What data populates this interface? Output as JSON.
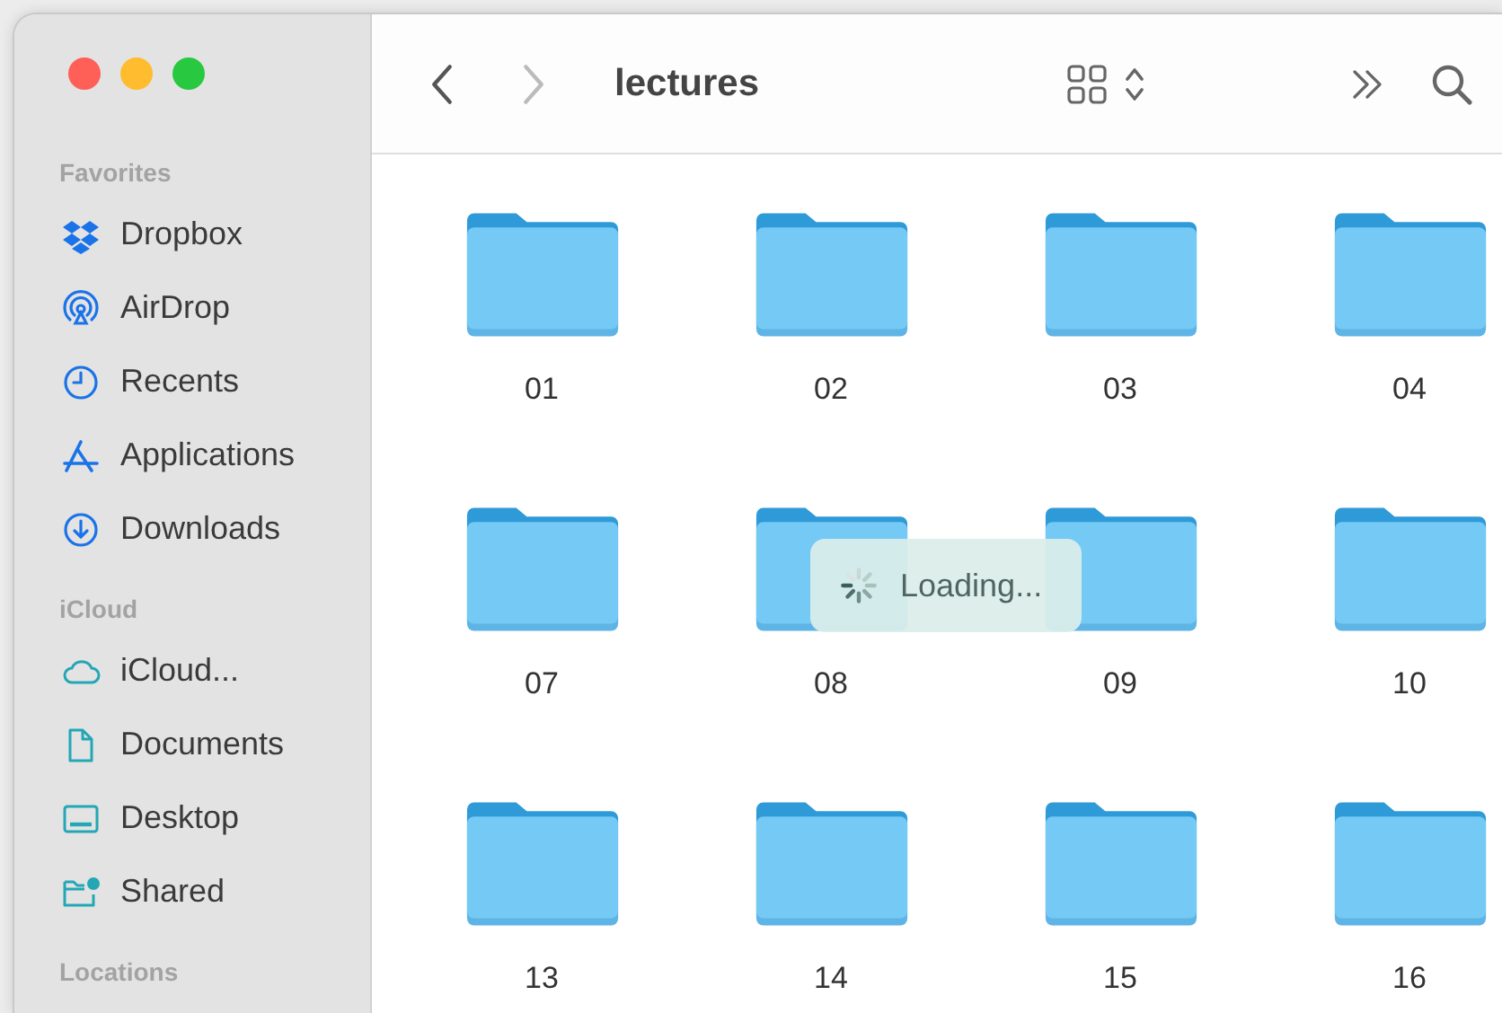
{
  "window": {
    "title": "lectures"
  },
  "toolbar": {
    "back": {
      "disabled": false
    },
    "forward": {
      "disabled": true
    }
  },
  "sidebar": {
    "sections": [
      {
        "header": "Favorites",
        "items": [
          {
            "label": "Dropbox",
            "kind": "dropbox"
          },
          {
            "label": "AirDrop",
            "kind": "airdrop"
          },
          {
            "label": "Recents",
            "kind": "clock"
          },
          {
            "label": "Applications",
            "kind": "apps"
          },
          {
            "label": "Downloads",
            "kind": "download"
          }
        ]
      },
      {
        "header": "iCloud",
        "items": [
          {
            "label": "iCloud...",
            "kind": "cloud"
          },
          {
            "label": "Documents",
            "kind": "document"
          },
          {
            "label": "Desktop",
            "kind": "desktop"
          },
          {
            "label": "Shared",
            "kind": "shared"
          }
        ]
      },
      {
        "header": "Locations"
      }
    ]
  },
  "folders": [
    {
      "name": "01"
    },
    {
      "name": "02"
    },
    {
      "name": "03"
    },
    {
      "name": "04"
    },
    {
      "name": "07"
    },
    {
      "name": "08"
    },
    {
      "name": "09"
    },
    {
      "name": "10"
    },
    {
      "name": "13"
    },
    {
      "name": "14"
    },
    {
      "name": "15"
    },
    {
      "name": "16"
    }
  ],
  "overlay": {
    "text": "Loading..."
  }
}
